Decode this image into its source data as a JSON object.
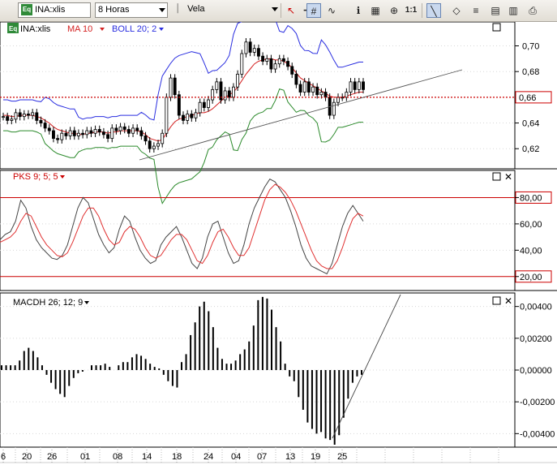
{
  "toolbar": {
    "symbol_badge": "Eq",
    "symbol": "INA:xlis",
    "timeframe": "8 Horas",
    "chart_type": "Vela",
    "scale_label": "1:1",
    "icons": [
      "cursor-icon",
      "crosshair-icon",
      "grid-icon",
      "wave-icon",
      "indicator-icon",
      "properties-icon",
      "zoom-icon",
      "scale-icon",
      "trendline-icon",
      "eraser-icon",
      "stack-icon",
      "bars-icon",
      "print-icon"
    ]
  },
  "panes": {
    "price": {
      "legend_symbol": "INA:xlis",
      "legend_ma": "MA 10",
      "legend_boll": "BOLL 20; 2",
      "ticks": [
        "0,70",
        "0,68",
        "0,66",
        "0,64",
        "0,62"
      ],
      "tick_values": [
        0.7,
        0.68,
        0.66,
        0.64,
        0.62
      ],
      "last_price_label": "0,66",
      "last_price": 0.66
    },
    "pks": {
      "legend": "PKS 9; 5; 5",
      "ticks": [
        "80,00",
        "60,00",
        "40,00",
        "20,00"
      ],
      "tick_values": [
        80,
        60,
        40,
        20
      ]
    },
    "macd": {
      "legend": "MACDH 26; 12; 9",
      "ticks": [
        "0,00400",
        "0,00200",
        "0,00000",
        "-0,00200",
        "-0,00400"
      ],
      "tick_values": [
        0.004,
        0.002,
        0.0,
        -0.002,
        -0.004
      ]
    }
  },
  "x_axis": {
    "labels": [
      "6",
      "20",
      "26",
      "01",
      "08",
      "14",
      "18",
      "24",
      "04",
      "07",
      "13",
      "19",
      "25"
    ]
  },
  "colors": {
    "bollinger": "#2a2ee0",
    "moving_average": "#d42020",
    "lower_band": "#2b8a2b",
    "pks_fast": "#444444",
    "pks_slow": "#e03030",
    "overbought_line": "#cc0000",
    "price_line": "#cc0000"
  },
  "chart_data": [
    {
      "type": "candlestick",
      "title": "",
      "series": [
        {
          "name": "INA:xlis",
          "values": [
            0.645,
            0.642,
            0.643,
            0.648,
            0.645,
            0.647,
            0.646,
            0.648,
            0.642,
            0.64,
            0.636,
            0.634,
            0.628,
            0.627,
            0.632,
            0.63,
            0.634,
            0.63,
            0.632,
            0.631,
            0.634,
            0.632,
            0.635,
            0.633,
            0.631,
            0.628,
            0.636,
            0.634,
            0.637,
            0.635,
            0.632,
            0.636,
            0.634,
            0.63,
            0.626,
            0.62,
            0.622,
            0.624,
            0.632,
            0.66,
            0.675,
            0.662,
            0.646,
            0.642,
            0.647,
            0.644,
            0.648,
            0.656,
            0.652,
            0.658,
            0.666,
            0.672,
            0.658,
            0.665,
            0.66,
            0.668,
            0.678,
            0.694,
            0.703,
            0.695,
            0.698,
            0.692,
            0.688,
            0.69,
            0.682,
            0.686,
            0.69,
            0.688,
            0.684,
            0.678,
            0.67,
            0.664,
            0.672,
            0.664,
            0.668,
            0.662,
            0.664,
            0.66,
            0.646,
            0.656,
            0.66,
            0.66,
            0.664,
            0.672,
            0.666,
            0.672,
            0.666
          ]
        },
        {
          "name": "MA 10",
          "values": [
            0.646,
            0.646,
            0.645,
            0.645,
            0.646,
            0.646,
            0.646,
            0.646,
            0.645,
            0.644,
            0.642,
            0.64,
            0.637,
            0.635,
            0.634,
            0.633,
            0.632,
            0.632,
            0.631,
            0.631,
            0.632,
            0.632,
            0.633,
            0.633,
            0.633,
            0.632,
            0.633,
            0.633,
            0.634,
            0.634,
            0.634,
            0.634,
            0.634,
            0.633,
            0.631,
            0.628,
            0.627,
            0.626,
            0.627,
            0.632,
            0.637,
            0.641,
            0.643,
            0.644,
            0.645,
            0.646,
            0.647,
            0.648,
            0.648,
            0.649,
            0.651,
            0.654,
            0.657,
            0.66,
            0.662,
            0.664,
            0.668,
            0.673,
            0.678,
            0.682,
            0.686,
            0.688,
            0.689,
            0.69,
            0.69,
            0.689,
            0.689,
            0.688,
            0.686,
            0.683,
            0.679,
            0.675,
            0.673,
            0.671,
            0.669,
            0.667,
            0.665,
            0.663,
            0.661,
            0.66,
            0.66,
            0.66,
            0.661,
            0.662,
            0.663,
            0.664,
            0.664
          ]
        }
      ],
      "ylim": [
        0.605,
        0.718
      ],
      "last_price": 0.66
    },
    {
      "type": "line",
      "title": "",
      "series": [
        {
          "name": "PKS fast",
          "values": [
            48,
            52,
            54,
            62,
            78,
            72,
            58,
            48,
            42,
            38,
            34,
            33,
            36,
            44,
            58,
            72,
            80,
            76,
            64,
            52,
            44,
            38,
            42,
            56,
            66,
            62,
            50,
            40,
            34,
            30,
            32,
            44,
            50,
            54,
            58,
            50,
            40,
            30,
            26,
            34,
            50,
            60,
            62,
            50,
            38,
            30,
            32,
            44,
            60,
            72,
            80,
            88,
            94,
            92,
            86,
            80,
            70,
            58,
            44,
            34,
            28,
            26,
            24,
            22,
            30,
            44,
            58,
            68,
            74,
            68,
            62
          ]
        },
        {
          "name": "PKS slow",
          "values": [
            46,
            48,
            50,
            54,
            62,
            68,
            66,
            58,
            50,
            44,
            40,
            36,
            35,
            38,
            46,
            56,
            66,
            72,
            72,
            66,
            56,
            48,
            44,
            46,
            54,
            58,
            56,
            50,
            42,
            36,
            34,
            36,
            42,
            48,
            52,
            52,
            48,
            40,
            32,
            30,
            36,
            46,
            54,
            56,
            50,
            42,
            36,
            36,
            42,
            54,
            66,
            78,
            86,
            90,
            88,
            84,
            78,
            70,
            60,
            50,
            40,
            32,
            28,
            26,
            26,
            32,
            42,
            54,
            64,
            68,
            66
          ]
        }
      ],
      "ylim": [
        10,
        100
      ],
      "reference_lines": [
        80,
        20
      ]
    },
    {
      "type": "bar",
      "title": "",
      "series": [
        {
          "name": "MACDH 26; 12; 9",
          "values": [
            0.0003,
            0.0003,
            0.0003,
            0.0003,
            0.0006,
            0.0012,
            0.0014,
            0.0012,
            0.0008,
            0.0003,
            -0.0003,
            -0.0008,
            -0.0012,
            -0.0015,
            -0.0017,
            -0.001,
            -0.0005,
            -0.0002,
            -0.0001,
            0.0,
            0.0003,
            0.0003,
            0.0003,
            0.0004,
            0.0002,
            0.0,
            0.0003,
            0.0005,
            0.0005,
            0.0008,
            0.001,
            0.0009,
            0.0007,
            0.0004,
            0.0002,
            0.0001,
            -0.0003,
            -0.0007,
            -0.001,
            -0.0011,
            0.0005,
            0.001,
            0.0022,
            0.003,
            0.004,
            0.0043,
            0.0037,
            0.0027,
            0.0014,
            0.0007,
            0.0004,
            0.0004,
            0.0006,
            0.001,
            0.0013,
            0.0018,
            0.0028,
            0.0044,
            0.0046,
            0.0045,
            0.0038,
            0.0027,
            0.0018,
            0.0004,
            -0.0004,
            -0.0007,
            -0.0017,
            -0.0025,
            -0.0033,
            -0.0037,
            -0.004,
            -0.0039,
            -0.0043,
            -0.0044,
            -0.0047,
            -0.0041,
            -0.003,
            -0.0018,
            -0.0008,
            -0.0004,
            -0.0003
          ]
        }
      ],
      "ylim": [
        -0.0048,
        0.0048
      ]
    }
  ]
}
